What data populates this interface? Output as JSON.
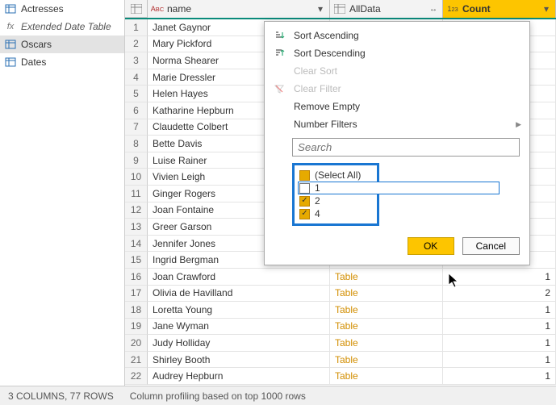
{
  "sidebar": {
    "items": [
      {
        "label": "Actresses",
        "icon": "table-icon"
      },
      {
        "label": "Extended Date Table",
        "icon": "fx-icon",
        "style": "fx"
      },
      {
        "label": "Oscars",
        "icon": "table-icon",
        "selected": true
      },
      {
        "label": "Dates",
        "icon": "table-icon"
      }
    ]
  },
  "columns": {
    "name": {
      "label": "name",
      "type_icon": "text-type-icon"
    },
    "alldata": {
      "label": "AllData",
      "type_icon": "table-type-icon"
    },
    "count": {
      "label": "Count",
      "type_icon": "number-type-icon"
    }
  },
  "rows": [
    {
      "idx": "1",
      "name": "Janet Gaynor",
      "alldata": "",
      "count": ""
    },
    {
      "idx": "2",
      "name": "Mary Pickford",
      "alldata": "",
      "count": ""
    },
    {
      "idx": "3",
      "name": "Norma Shearer",
      "alldata": "",
      "count": ""
    },
    {
      "idx": "4",
      "name": "Marie Dressler",
      "alldata": "",
      "count": ""
    },
    {
      "idx": "5",
      "name": "Helen Hayes",
      "alldata": "",
      "count": ""
    },
    {
      "idx": "6",
      "name": "Katharine Hepburn",
      "alldata": "",
      "count": ""
    },
    {
      "idx": "7",
      "name": "Claudette Colbert",
      "alldata": "",
      "count": ""
    },
    {
      "idx": "8",
      "name": "Bette Davis",
      "alldata": "",
      "count": ""
    },
    {
      "idx": "9",
      "name": "Luise Rainer",
      "alldata": "",
      "count": ""
    },
    {
      "idx": "10",
      "name": "Vivien Leigh",
      "alldata": "",
      "count": ""
    },
    {
      "idx": "11",
      "name": "Ginger Rogers",
      "alldata": "",
      "count": ""
    },
    {
      "idx": "12",
      "name": "Joan Fontaine",
      "alldata": "",
      "count": ""
    },
    {
      "idx": "13",
      "name": "Greer Garson",
      "alldata": "",
      "count": ""
    },
    {
      "idx": "14",
      "name": "Jennifer Jones",
      "alldata": "",
      "count": ""
    },
    {
      "idx": "15",
      "name": "Ingrid Bergman",
      "alldata": "",
      "count": ""
    },
    {
      "idx": "16",
      "name": "Joan Crawford",
      "alldata": "Table",
      "count": "1"
    },
    {
      "idx": "17",
      "name": "Olivia de Havilland",
      "alldata": "Table",
      "count": "2"
    },
    {
      "idx": "18",
      "name": "Loretta Young",
      "alldata": "Table",
      "count": "1"
    },
    {
      "idx": "19",
      "name": "Jane Wyman",
      "alldata": "Table",
      "count": "1"
    },
    {
      "idx": "20",
      "name": "Judy Holliday",
      "alldata": "Table",
      "count": "1"
    },
    {
      "idx": "21",
      "name": "Shirley Booth",
      "alldata": "Table",
      "count": "1"
    },
    {
      "idx": "22",
      "name": "Audrey Hepburn",
      "alldata": "Table",
      "count": "1"
    }
  ],
  "filter": {
    "sort_asc": "Sort Ascending",
    "sort_desc": "Sort Descending",
    "clear_sort": "Clear Sort",
    "clear_filter": "Clear Filter",
    "remove_empty": "Remove Empty",
    "number_filters": "Number Filters",
    "search_placeholder": "Search",
    "select_all": "(Select All)",
    "opt1": "1",
    "opt2": "2",
    "opt4": "4",
    "ok": "OK",
    "cancel": "Cancel"
  },
  "status": {
    "cols_rows": "3 COLUMNS, 77 ROWS",
    "profiling": "Column profiling based on top 1000 rows"
  }
}
